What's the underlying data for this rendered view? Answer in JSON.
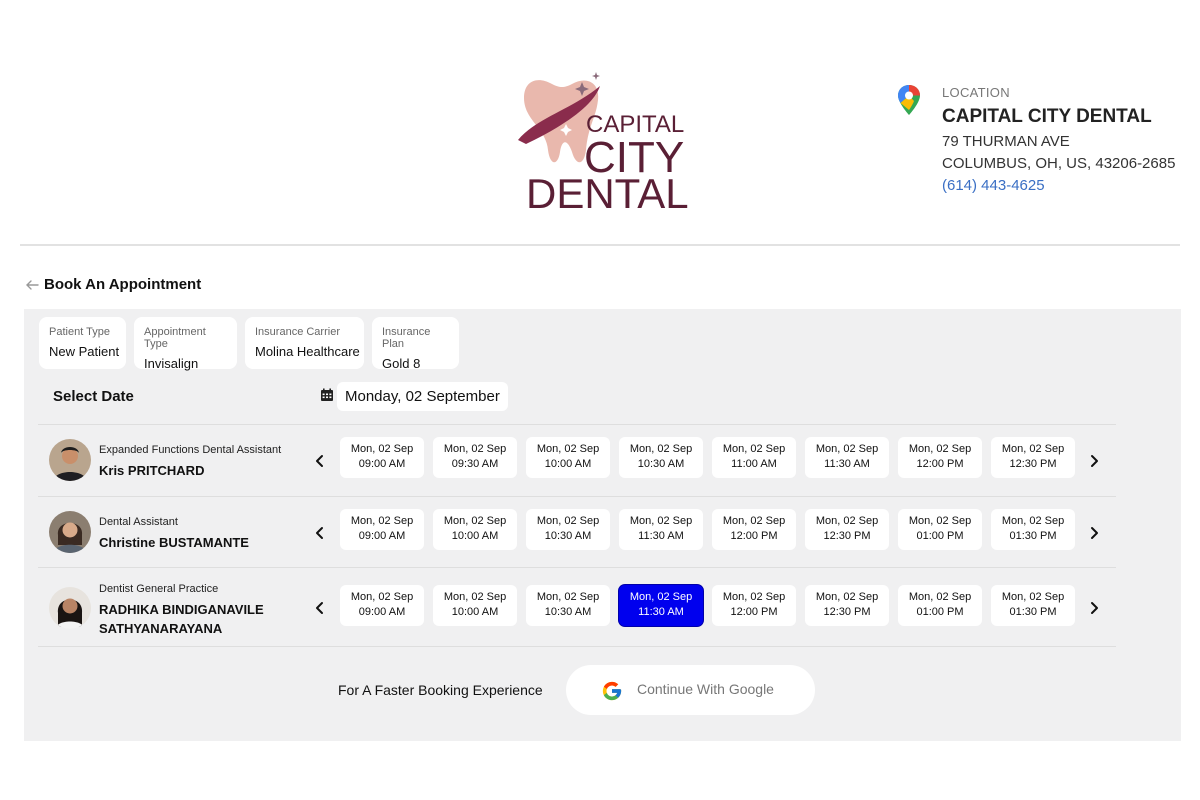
{
  "brand": {
    "logo_lines": [
      "CAPITAL",
      "CITY",
      "DENTAL"
    ],
    "colors": {
      "logo_text": "#5a1f35",
      "tooth": "#e9b8ad",
      "swoosh": "#8a2c4c"
    }
  },
  "location": {
    "label": "LOCATION",
    "name": "CAPITAL CITY DENTAL",
    "street": "79 THURMAN AVE",
    "city": "COLUMBUS, OH, US, 43206-2685",
    "phone": "(614) 443-4625",
    "icon": "map-pin-icon"
  },
  "page": {
    "title": "Book An Appointment",
    "back_icon": "back-arrow-icon"
  },
  "filters": [
    {
      "label": "Patient Type",
      "value": "New Patient"
    },
    {
      "label": "Appointment Type",
      "value": "Invisalign"
    },
    {
      "label": "Insurance Carrier",
      "value": "Molina Healthcare"
    },
    {
      "label": "Insurance Plan",
      "value": "Gold 8"
    }
  ],
  "date_selector": {
    "label": "Select Date",
    "value": "Monday, 02 September",
    "icon": "calendar-icon"
  },
  "providers": [
    {
      "role": "Expanded Functions Dental Assistant",
      "name": "Kris PRITCHARD",
      "slots": [
        {
          "date": "Mon, 02 Sep",
          "time": "09:00 AM"
        },
        {
          "date": "Mon, 02 Sep",
          "time": "09:30 AM"
        },
        {
          "date": "Mon, 02 Sep",
          "time": "10:00 AM"
        },
        {
          "date": "Mon, 02 Sep",
          "time": "10:30 AM"
        },
        {
          "date": "Mon, 02 Sep",
          "time": "11:00 AM"
        },
        {
          "date": "Mon, 02 Sep",
          "time": "11:30 AM"
        },
        {
          "date": "Mon, 02 Sep",
          "time": "12:00 PM"
        },
        {
          "date": "Mon, 02 Sep",
          "time": "12:30 PM"
        }
      ]
    },
    {
      "role": "Dental Assistant",
      "name": "Christine BUSTAMANTE",
      "slots": [
        {
          "date": "Mon, 02 Sep",
          "time": "09:00 AM"
        },
        {
          "date": "Mon, 02 Sep",
          "time": "10:00 AM"
        },
        {
          "date": "Mon, 02 Sep",
          "time": "10:30 AM"
        },
        {
          "date": "Mon, 02 Sep",
          "time": "11:30 AM"
        },
        {
          "date": "Mon, 02 Sep",
          "time": "12:00 PM"
        },
        {
          "date": "Mon, 02 Sep",
          "time": "12:30 PM"
        },
        {
          "date": "Mon, 02 Sep",
          "time": "01:00 PM"
        },
        {
          "date": "Mon, 02 Sep",
          "time": "01:30 PM"
        }
      ]
    },
    {
      "role": "Dentist General Practice",
      "name": "RADHIKA BINDIGANAVILE SATHYANARAYANA",
      "name_lines": [
        "RADHIKA BINDIGANAVILE",
        "SATHYANARAYANA"
      ],
      "slots": [
        {
          "date": "Mon, 02 Sep",
          "time": "09:00 AM"
        },
        {
          "date": "Mon, 02 Sep",
          "time": "10:00 AM"
        },
        {
          "date": "Mon, 02 Sep",
          "time": "10:30 AM"
        },
        {
          "date": "Mon, 02 Sep",
          "time": "11:30 AM",
          "selected": true
        },
        {
          "date": "Mon, 02 Sep",
          "time": "12:00 PM"
        },
        {
          "date": "Mon, 02 Sep",
          "time": "12:30 PM"
        },
        {
          "date": "Mon, 02 Sep",
          "time": "01:00 PM"
        },
        {
          "date": "Mon, 02 Sep",
          "time": "01:30 PM"
        }
      ]
    }
  ],
  "google": {
    "prompt": "For A Faster Booking Experience",
    "button_label": "Continue With Google",
    "icon": "google-icon"
  },
  "colors": {
    "selected_slot": "#0000ee",
    "panel_bg": "#f0f0f1",
    "phone_link": "#3a6fc4"
  }
}
